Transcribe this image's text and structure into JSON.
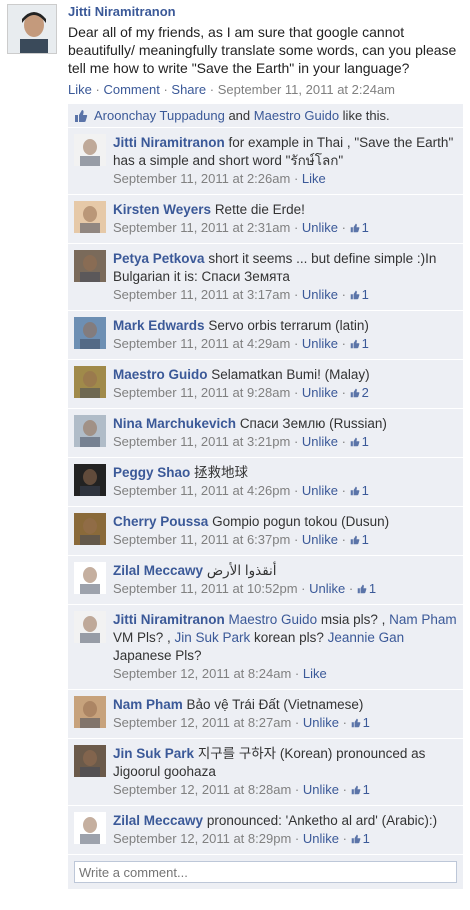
{
  "post": {
    "author": "Jitti Niramitranon",
    "text": "Dear all of my friends, as I am sure that google cannot beautifully/ meaningfully translate some words, can you please tell me how to write \"Save the Earth\" in your language?",
    "actions": {
      "like": "Like",
      "comment": "Comment",
      "share": "Share",
      "timestamp": "September 11, 2011 at 2:24am"
    }
  },
  "likes": {
    "user1": "Aroonchay Tuppadung",
    "and": "and",
    "user2": "Maestro Guido",
    "suffix": "like this."
  },
  "comments": [
    {
      "author": "Jitti Niramitranon",
      "text": "for example in Thai , \"Save the Earth\" has a simple and short word \"รักษ์โลก\"",
      "time": "September 11, 2011 at 2:26am",
      "action": "Like",
      "likes": ""
    },
    {
      "author": "Kirsten Weyers",
      "text": "Rette die Erde!",
      "time": "September 11, 2011 at 2:31am",
      "action": "Unlike",
      "likes": "1"
    },
    {
      "author": "Petya Petkova",
      "text": "short it seems ... but define simple :)In Bulgarian it is: Спаси Земята",
      "time": "September 11, 2011 at 3:17am",
      "action": "Unlike",
      "likes": "1"
    },
    {
      "author": "Mark Edwards",
      "text": "Servo orbis terrarum (latin)",
      "time": "September 11, 2011 at 4:29am",
      "action": "Unlike",
      "likes": "1"
    },
    {
      "author": "Maestro Guido",
      "text": "Selamatkan Bumi! (Malay)",
      "time": "September 11, 2011 at 9:28am",
      "action": "Unlike",
      "likes": "2"
    },
    {
      "author": "Nina Marchukevich",
      "text": "Спаси Землю (Russian)",
      "time": "September 11, 2011 at 3:21pm",
      "action": "Unlike",
      "likes": "1"
    },
    {
      "author": "Peggy Shao",
      "text": "拯救地球",
      "time": "September 11, 2011 at 4:26pm",
      "action": "Unlike",
      "likes": "1"
    },
    {
      "author": "Cherry Poussa",
      "text": "Gompio pogun tokou (Dusun)",
      "time": "September 11, 2011 at 6:37pm",
      "action": "Unlike",
      "likes": "1"
    },
    {
      "author": "Zilal Meccawy",
      "text": "أنقذوا الأرض",
      "time": "September 11, 2011 at 10:52pm",
      "action": "Unlike",
      "likes": "1"
    },
    {
      "author": "Jitti Niramitranon",
      "mentions": [
        {
          "type": "link",
          "text": "Maestro Guido"
        },
        {
          "type": "text",
          "text": " msia pls? , "
        },
        {
          "type": "link",
          "text": "Nam Pham"
        },
        {
          "type": "text",
          "text": " VM Pls? , "
        },
        {
          "type": "link",
          "text": "Jin Suk Park"
        },
        {
          "type": "text",
          "text": " korean pls? "
        },
        {
          "type": "link",
          "text": "Jeannie Gan"
        },
        {
          "type": "text",
          "text": " Japanese Pls?"
        }
      ],
      "time": "September 12, 2011 at 8:24am",
      "action": "Like",
      "likes": ""
    },
    {
      "author": "Nam Pham",
      "text": "Bảo vệ Trái Đất (Vietnamese)",
      "time": "September 12, 2011 at 8:27am",
      "action": "Unlike",
      "likes": "1"
    },
    {
      "author": "Jin Suk Park",
      "text": "지구를 구하자 (Korean) pronounced as Jigoorul goohaza",
      "time": "September 12, 2011 at 8:28am",
      "action": "Unlike",
      "likes": "1"
    },
    {
      "author": "Zilal Meccawy",
      "text": "pronounced: 'Anketho al ard' (Arabic):)",
      "time": "September 12, 2011 at 8:29pm",
      "action": "Unlike",
      "likes": "1"
    }
  ],
  "write_comment": {
    "placeholder": "Write a comment..."
  },
  "separator": "·",
  "icons": {
    "thumbs_up": "thumbs-up-icon"
  }
}
